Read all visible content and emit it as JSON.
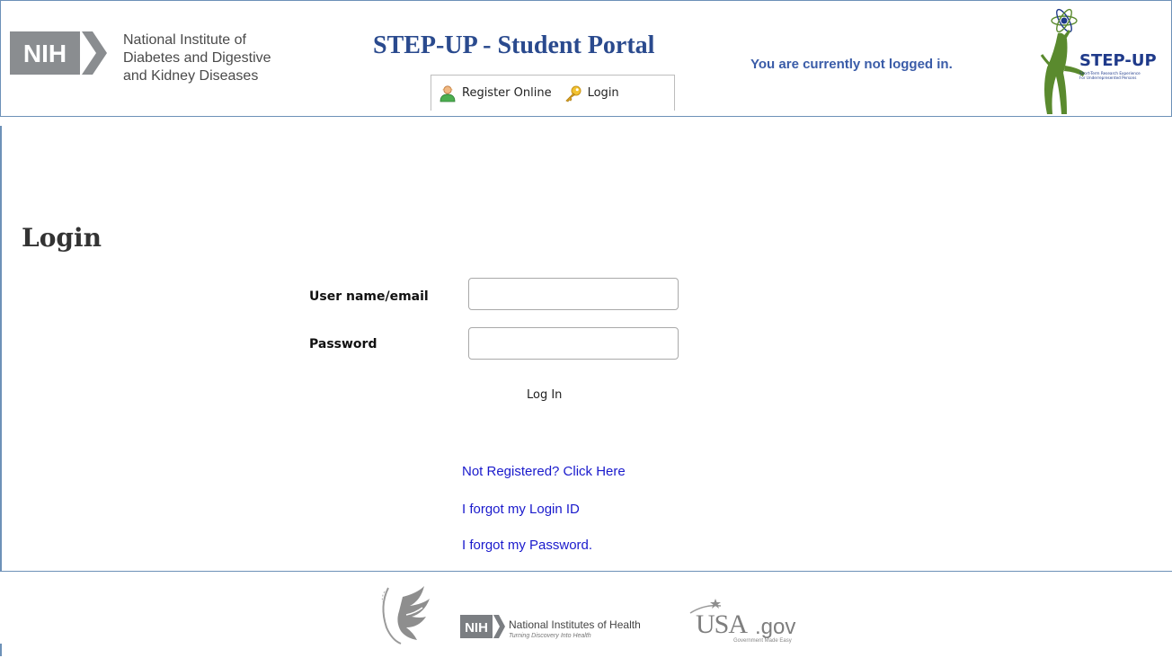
{
  "header": {
    "nih_badge": "NIH",
    "institute_lines": [
      "National Institute of",
      "Diabetes and Digestive",
      "and Kidney Diseases"
    ],
    "portal_title": "STEP-UP - Student Portal",
    "status": "You are currently not logged in.",
    "nav": [
      {
        "label": "Register Online",
        "icon": "user-add-icon"
      },
      {
        "label": "Login",
        "icon": "key-icon"
      }
    ],
    "stepup_logo": {
      "name": "STEP-UP",
      "tagline_1": "Short-Term Research Experience",
      "tagline_2": "For Underrepresented Persons"
    }
  },
  "main": {
    "title": "Login",
    "username_label": "User name/email",
    "username_value": "",
    "password_label": "Password",
    "password_value": "",
    "login_button": "Log In",
    "links": [
      "Not Registered? Click Here",
      "I forgot my Login ID",
      "I forgot my Password."
    ]
  },
  "footer": {
    "hhs_logo": "hhs-eagle-seal-icon",
    "nih_badge": "NIH",
    "nih_name": "National Institutes of Health",
    "nih_tagline": "Turning Discovery Into Health",
    "usa_main": "USA",
    "usa_gov": ".gov",
    "usa_tagline": "Government Made Easy"
  },
  "colors": {
    "border": "#6d91b8",
    "title_blue": "#2a4a8e",
    "status_blue": "#3a5ca8",
    "link_blue": "#1a1acc",
    "stepup_green": "#5a8a2e",
    "stepup_blue": "#1f3a8a"
  }
}
